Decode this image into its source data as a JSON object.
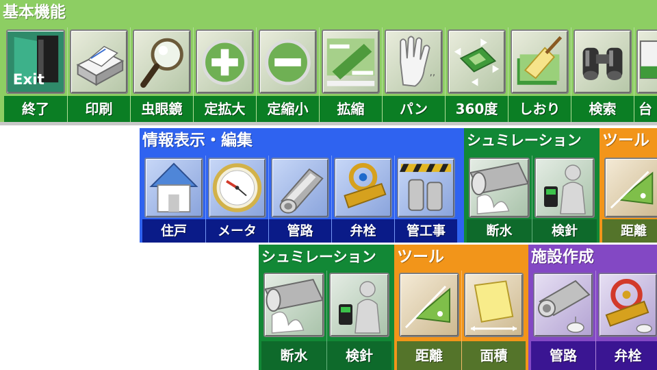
{
  "basic": {
    "title": "基本機能",
    "buttons": [
      {
        "label": "終了",
        "icon": "exit-icon",
        "icon_text": "Exit"
      },
      {
        "label": "印刷",
        "icon": "printer-icon"
      },
      {
        "label": "虫眼鏡",
        "icon": "magnifier-icon"
      },
      {
        "label": "定拡大",
        "icon": "zoom-in-icon"
      },
      {
        "label": "定縮小",
        "icon": "zoom-out-icon"
      },
      {
        "label": "拡縮",
        "icon": "zoom-scale-icon"
      },
      {
        "label": "パン",
        "icon": "hand-pan-icon"
      },
      {
        "label": "360度",
        "icon": "rotate-map-icon"
      },
      {
        "label": "しおり",
        "icon": "bookmark-icon"
      },
      {
        "label": "検索",
        "icon": "binoculars-icon"
      },
      {
        "label": "台",
        "icon": "ledger-icon"
      }
    ]
  },
  "info": {
    "title": "情報表示・編集",
    "buttons": [
      {
        "label": "住戸",
        "icon": "house-icon"
      },
      {
        "label": "メータ",
        "icon": "meter-icon"
      },
      {
        "label": "管路",
        "icon": "pipe-icon"
      },
      {
        "label": "弁栓",
        "icon": "valve-icon"
      },
      {
        "label": "管工事",
        "icon": "pipe-construction-icon"
      }
    ]
  },
  "simulation_top": {
    "title": "シュミレーション",
    "buttons": [
      {
        "label": "断水",
        "icon": "water-outage-icon"
      },
      {
        "label": "検針",
        "icon": "meter-reading-icon"
      }
    ]
  },
  "tools_top": {
    "title": "ツール",
    "buttons": [
      {
        "label": "距離",
        "icon": "distance-icon"
      }
    ]
  },
  "simulation_bottom": {
    "title": "シュミレーション",
    "buttons": [
      {
        "label": "断水",
        "icon": "water-outage-icon"
      },
      {
        "label": "検針",
        "icon": "meter-reading-icon"
      }
    ]
  },
  "tools_bottom": {
    "title": "ツール",
    "buttons": [
      {
        "label": "距離",
        "icon": "distance-icon"
      },
      {
        "label": "面積",
        "icon": "area-icon"
      }
    ]
  },
  "facility": {
    "title": "施設作成",
    "buttons": [
      {
        "label": "管路",
        "icon": "pipe-create-icon"
      },
      {
        "label": "弁栓",
        "icon": "valve-create-icon"
      }
    ]
  },
  "colors": {
    "basic_bg": "#8dce63",
    "basic_label_bg": "#0b7e24",
    "info_bg": "#2f63f0",
    "info_label_bg": "#0a1b88",
    "simulation_bg": "#128836",
    "tools_bg": "#f2951a",
    "facility_bg": "#8348c4",
    "facility_label_bg": "#3a1592"
  }
}
